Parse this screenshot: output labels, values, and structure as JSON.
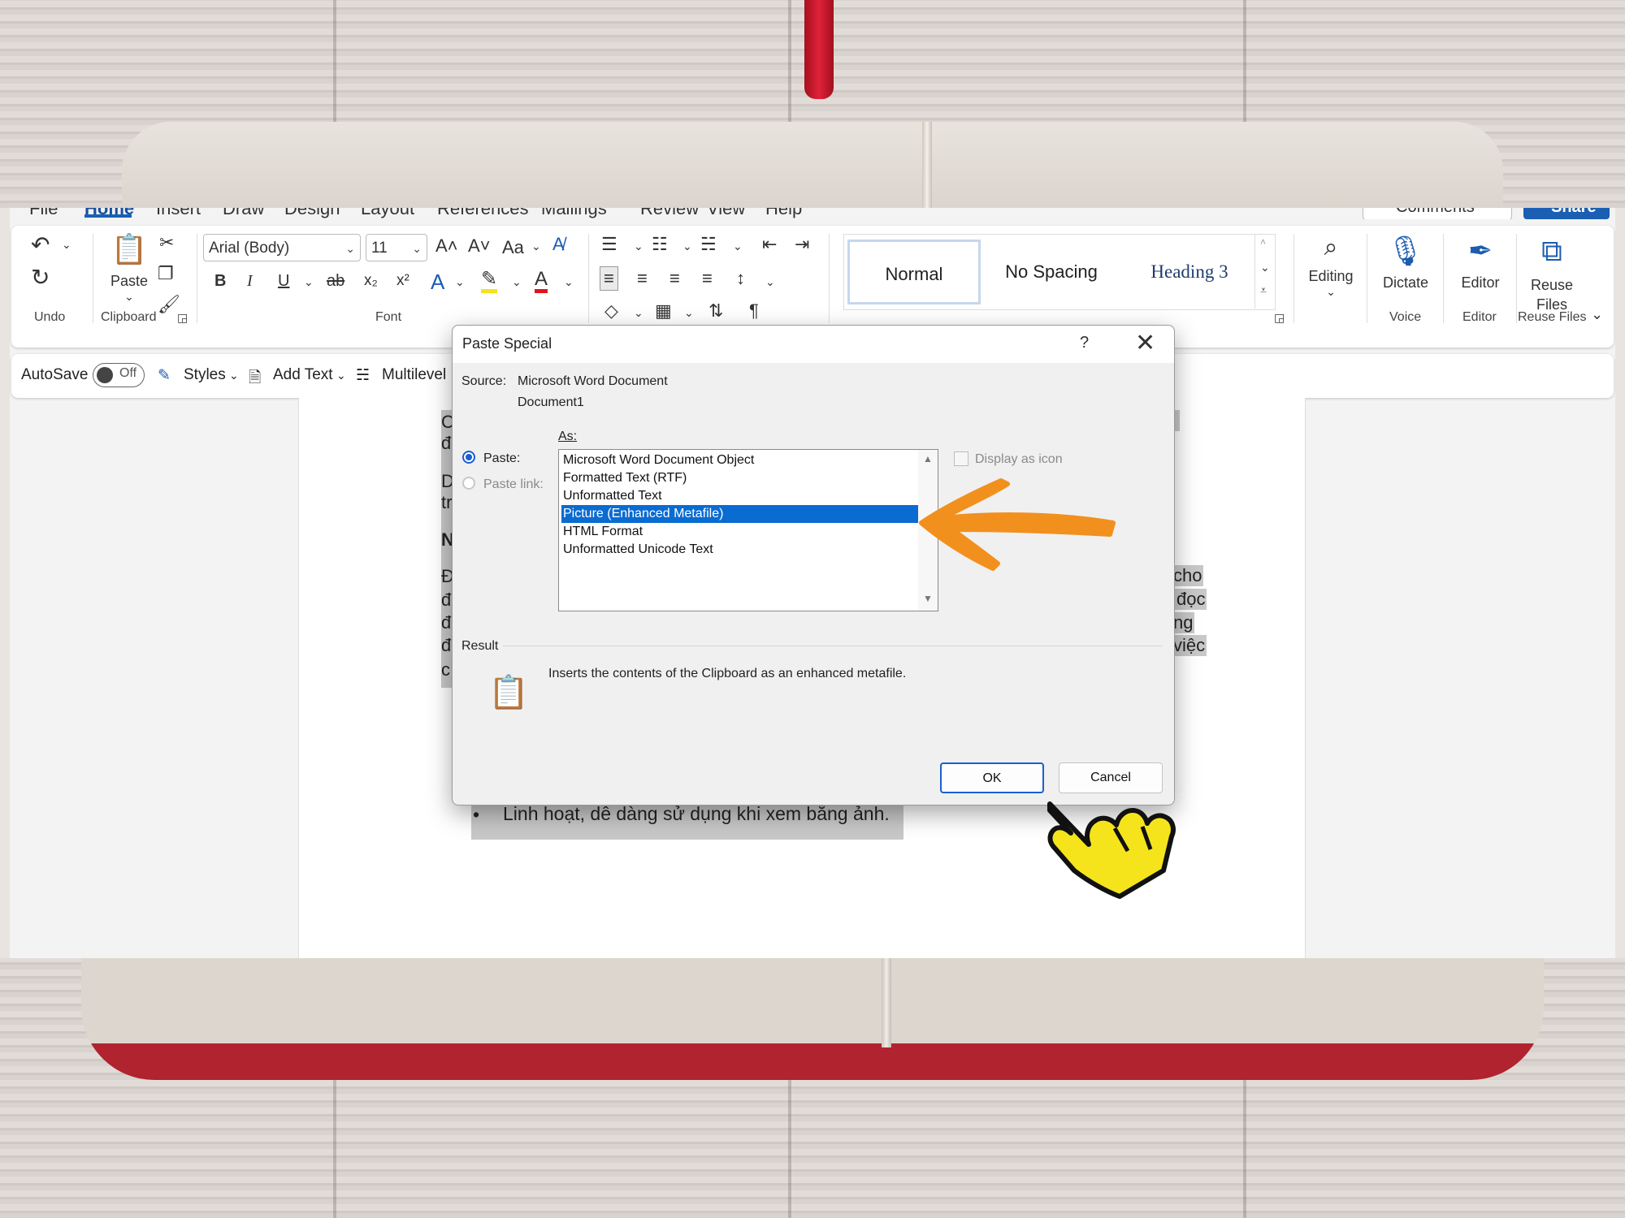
{
  "tabs": [
    "File",
    "Home",
    "Insert",
    "Draw",
    "Design",
    "Layout",
    "References",
    "Mailings",
    "Review",
    "View",
    "Help"
  ],
  "top_right": {
    "comments_label": "Comments",
    "share_label": "Share"
  },
  "ribbon": {
    "groups": {
      "undo": "Undo",
      "clipboard": "Clipboard",
      "font": "Font",
      "voice": "Voice",
      "editor": "Editor",
      "reuse_files": "Reuse Files"
    },
    "paste_label": "Paste",
    "font_name": "Arial (Body)",
    "font_size": "11",
    "change_case": "Aa",
    "bold": "B",
    "italic": "I",
    "underline": "U",
    "strike": "ab",
    "subscript": "x₂",
    "superscript": "x²",
    "styles": [
      "Normal",
      "No Spacing",
      "Heading 3"
    ],
    "editing_label": "Editing",
    "dictate_label": "Dictate",
    "editor_label": "Editor",
    "reuse_files_label": "Reuse Files"
  },
  "qat": {
    "autosave_label": "AutoSave",
    "autosave_state": "Off",
    "styles_label": "Styles",
    "add_text_label": "Add Text",
    "multilevel_label": "Multilevel L"
  },
  "document": {
    "bullet_text": "Linh hoạt, dễ dàng sử dụng khi xem bằng ảnh.",
    "fragments_left": [
      "C",
      "đ",
      "D",
      "tr",
      "N",
      "Đ",
      "đ",
      "đ",
      "đ",
      "c"
    ],
    "fragments_right": [
      "cho",
      "đọc",
      "ng",
      "việc"
    ]
  },
  "dialog": {
    "title": "Paste Special",
    "help": "?",
    "close": "✕",
    "source_label": "Source:",
    "source_value": "Microsoft Word Document",
    "source_doc": "Document1",
    "as_label": "As:",
    "paste_label": "Paste:",
    "paste_link_label": "Paste link:",
    "options": [
      "Microsoft Word Document Object",
      "Formatted Text (RTF)",
      "Unformatted Text",
      "Picture (Enhanced Metafile)",
      "HTML Format",
      "Unformatted Unicode Text"
    ],
    "selected_option": "Picture (Enhanced Metafile)",
    "display_as_icon": "Display as icon",
    "result_label": "Result",
    "result_text": "Inserts the contents of the Clipboard as an enhanced metafile.",
    "ok_label": "OK",
    "cancel_label": "Cancel"
  },
  "colors": {
    "accent": "#1a5fd0",
    "selection": "#0a6bd1",
    "arrow": "#f2901e",
    "hand": "#f5e41c"
  }
}
